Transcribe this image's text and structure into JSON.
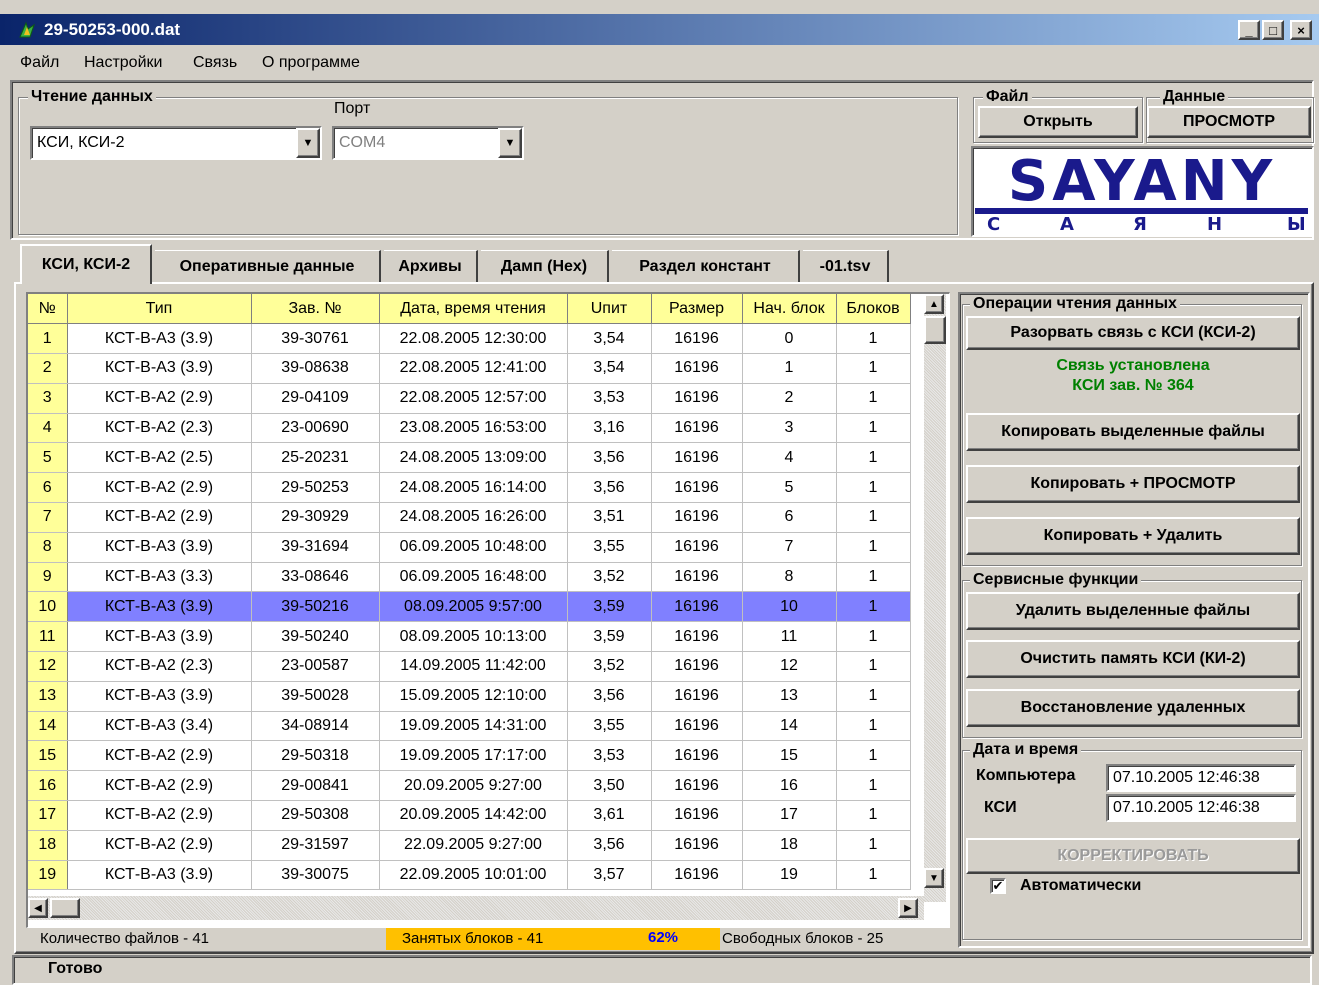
{
  "window": {
    "title": "29-50253-000.dat",
    "minimize": "_",
    "maximize": "□",
    "close": "×"
  },
  "menu": [
    "Файл",
    "Настройки",
    "Связь",
    "О программе"
  ],
  "read_group": {
    "label": "Чтение данных",
    "device": "КСИ, КСИ-2",
    "port_label": "Порт",
    "port": "COM4"
  },
  "file_group": {
    "label": "Файл",
    "open": "Открыть"
  },
  "data_group": {
    "label": "Данные",
    "view": "ПРОСМОТР"
  },
  "logo": {
    "brand": "SAYANY",
    "letters": [
      "С",
      "А",
      "Я",
      "Н",
      "Ы"
    ],
    "colors": {
      "primary": "#1a1a8c",
      "bg": "#ffffff"
    }
  },
  "tabs": [
    "КСИ, КСИ-2",
    "Оперативные данные",
    "Архивы",
    "Дамп (Hex)",
    "Раздел констант",
    "-01.tsv"
  ],
  "table": {
    "columns": [
      "№",
      "Тип",
      "Зав. №",
      "Дата, время чтения",
      "Uпит",
      "Размер",
      "Нач. блок",
      "Блоков"
    ],
    "selected_row": 10,
    "rows": [
      [
        "1",
        "КСТ-В-А3  (3.9)",
        "39-30761",
        "22.08.2005 12:30:00",
        "3,54",
        "16196",
        "0",
        "1"
      ],
      [
        "2",
        "КСТ-В-А3  (3.9)",
        "39-08638",
        "22.08.2005 12:41:00",
        "3,54",
        "16196",
        "1",
        "1"
      ],
      [
        "3",
        "КСТ-В-А2  (2.9)",
        "29-04109",
        "22.08.2005 12:57:00",
        "3,53",
        "16196",
        "2",
        "1"
      ],
      [
        "4",
        "КСТ-В-А2  (2.3)",
        "23-00690",
        "23.08.2005 16:53:00",
        "3,16",
        "16196",
        "3",
        "1"
      ],
      [
        "5",
        "КСТ-В-А2  (2.5)",
        "25-20231",
        "24.08.2005 13:09:00",
        "3,56",
        "16196",
        "4",
        "1"
      ],
      [
        "6",
        "КСТ-В-А2  (2.9)",
        "29-50253",
        "24.08.2005 16:14:00",
        "3,56",
        "16196",
        "5",
        "1"
      ],
      [
        "7",
        "КСТ-В-А2  (2.9)",
        "29-30929",
        "24.08.2005 16:26:00",
        "3,51",
        "16196",
        "6",
        "1"
      ],
      [
        "8",
        "КСТ-В-А3  (3.9)",
        "39-31694",
        "06.09.2005 10:48:00",
        "3,55",
        "16196",
        "7",
        "1"
      ],
      [
        "9",
        "КСТ-В-А3  (3.3)",
        "33-08646",
        "06.09.2005 16:48:00",
        "3,52",
        "16196",
        "8",
        "1"
      ],
      [
        "10",
        "КСТ-В-А3  (3.9)",
        "39-50216",
        "08.09.2005 9:57:00",
        "3,59",
        "16196",
        "10",
        "1"
      ],
      [
        "11",
        "КСТ-В-А3  (3.9)",
        "39-50240",
        "08.09.2005 10:13:00",
        "3,59",
        "16196",
        "11",
        "1"
      ],
      [
        "12",
        "КСТ-В-А2  (2.3)",
        "23-00587",
        "14.09.2005 11:42:00",
        "3,52",
        "16196",
        "12",
        "1"
      ],
      [
        "13",
        "КСТ-В-А3  (3.9)",
        "39-50028",
        "15.09.2005 12:10:00",
        "3,56",
        "16196",
        "13",
        "1"
      ],
      [
        "14",
        "КСТ-В-А3  (3.4)",
        "34-08914",
        "19.09.2005 14:31:00",
        "3,55",
        "16196",
        "14",
        "1"
      ],
      [
        "15",
        "КСТ-В-А2  (2.9)",
        "29-50318",
        "19.09.2005 17:17:00",
        "3,53",
        "16196",
        "15",
        "1"
      ],
      [
        "16",
        "КСТ-В-А2  (2.9)",
        "29-00841",
        "20.09.2005 9:27:00",
        "3,50",
        "16196",
        "16",
        "1"
      ],
      [
        "17",
        "КСТ-В-А2  (2.9)",
        "29-50308",
        "20.09.2005 14:42:00",
        "3,61",
        "16196",
        "17",
        "1"
      ],
      [
        "18",
        "КСТ-В-А2  (2.9)",
        "29-31597",
        "22.09.2005 9:27:00",
        "3,56",
        "16196",
        "18",
        "1"
      ],
      [
        "19",
        "КСТ-В-А3  (3.9)",
        "39-30075",
        "22.09.2005 10:01:00",
        "3,57",
        "16196",
        "19",
        "1"
      ]
    ]
  },
  "footer": {
    "file_count": "Количество файлов - 41",
    "used_blocks": "Занятых блоков   - 41",
    "percent": "62%",
    "free_blocks": "Свободных блоков - 25",
    "used_color": "#ffc000",
    "percent_color": "#0000ff"
  },
  "ops": {
    "label": "Операции чтения данных",
    "disconnect": "Разорвать связь с КСИ (КСИ-2)",
    "status_line1": "Связь установлена",
    "status_line2": "КСИ зав. № 364",
    "status_color": "#008000",
    "copy_selected": "Копировать выделенные файлы",
    "copy_view": "Копировать + ПРОСМОТР",
    "copy_delete": "Копировать + Удалить"
  },
  "service": {
    "label": "Сервисные функции",
    "delete_selected": "Удалить выделенные файлы",
    "clear_memory": "Очистить память КСИ (КИ-2)",
    "restore": "Восстановление удаленных"
  },
  "datetime": {
    "label": "Дата и время",
    "computer_label": "Компьютера",
    "computer_value": "07.10.2005 12:46:38",
    "ksi_label": "КСИ",
    "ksi_value": "07.10.2005 12:46:38",
    "correct": "КОРРЕКТИРОВАТЬ",
    "auto_label": "Автоматически",
    "auto_checked": true
  },
  "status": "Готово"
}
